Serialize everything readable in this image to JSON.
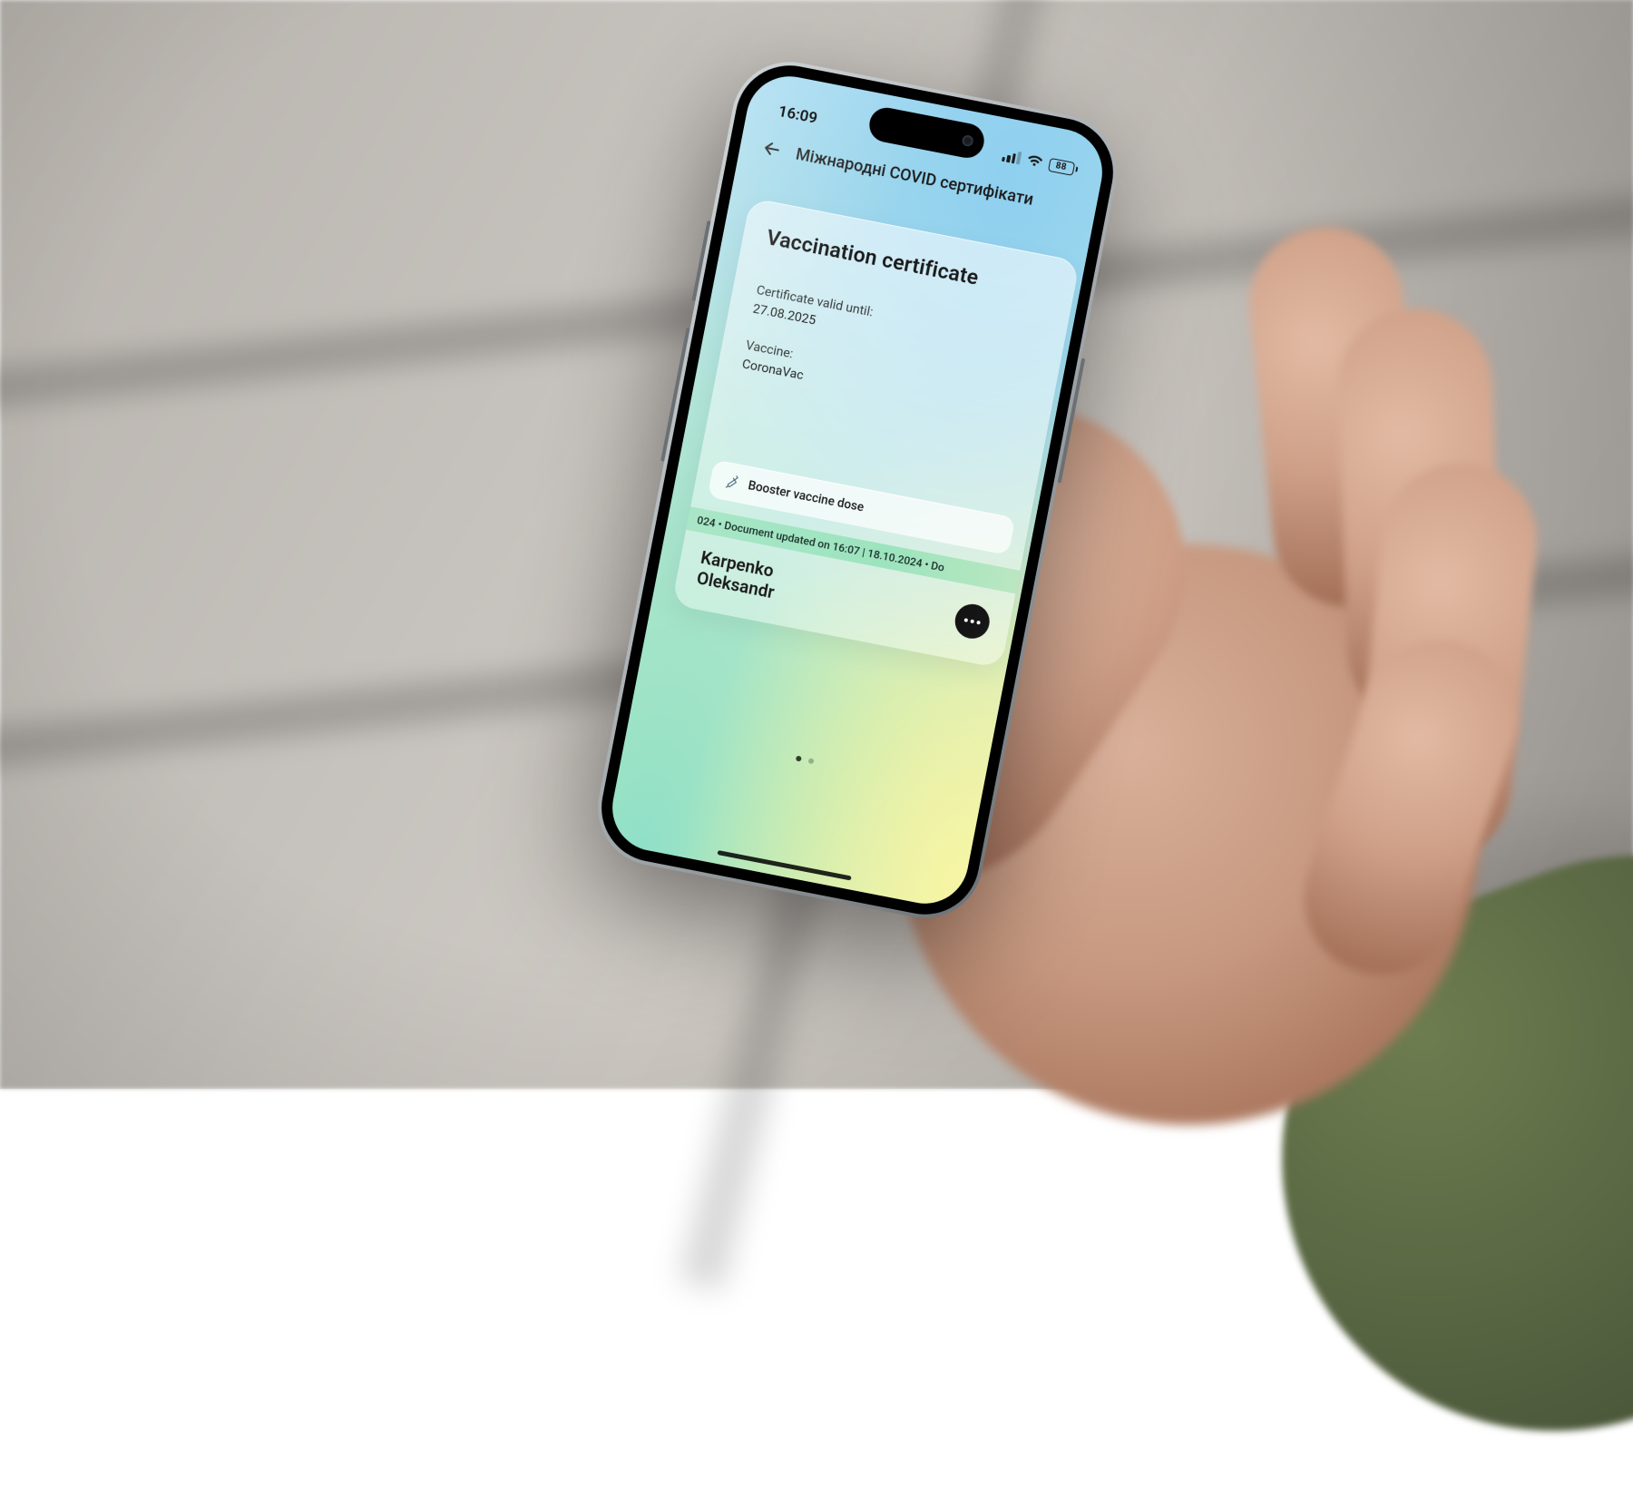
{
  "status": {
    "time": "16:09",
    "battery": "88"
  },
  "header": {
    "title": "Міжнародні COVID сертифікати"
  },
  "card": {
    "title": "Vaccination certificate",
    "valid_label": "Certificate valid until:",
    "valid_value": "27.08.2025",
    "vaccine_label": "Vaccine:",
    "vaccine_value": "CoronaVac",
    "booster_label": "Booster vaccine dose",
    "ticker": "024  •  Document updated on 16:07 | 18.10.2024  •  Do",
    "holder_line1": "Karpenko",
    "holder_line2": "Oleksandr"
  },
  "pager": {
    "count": 2,
    "active": 0
  }
}
